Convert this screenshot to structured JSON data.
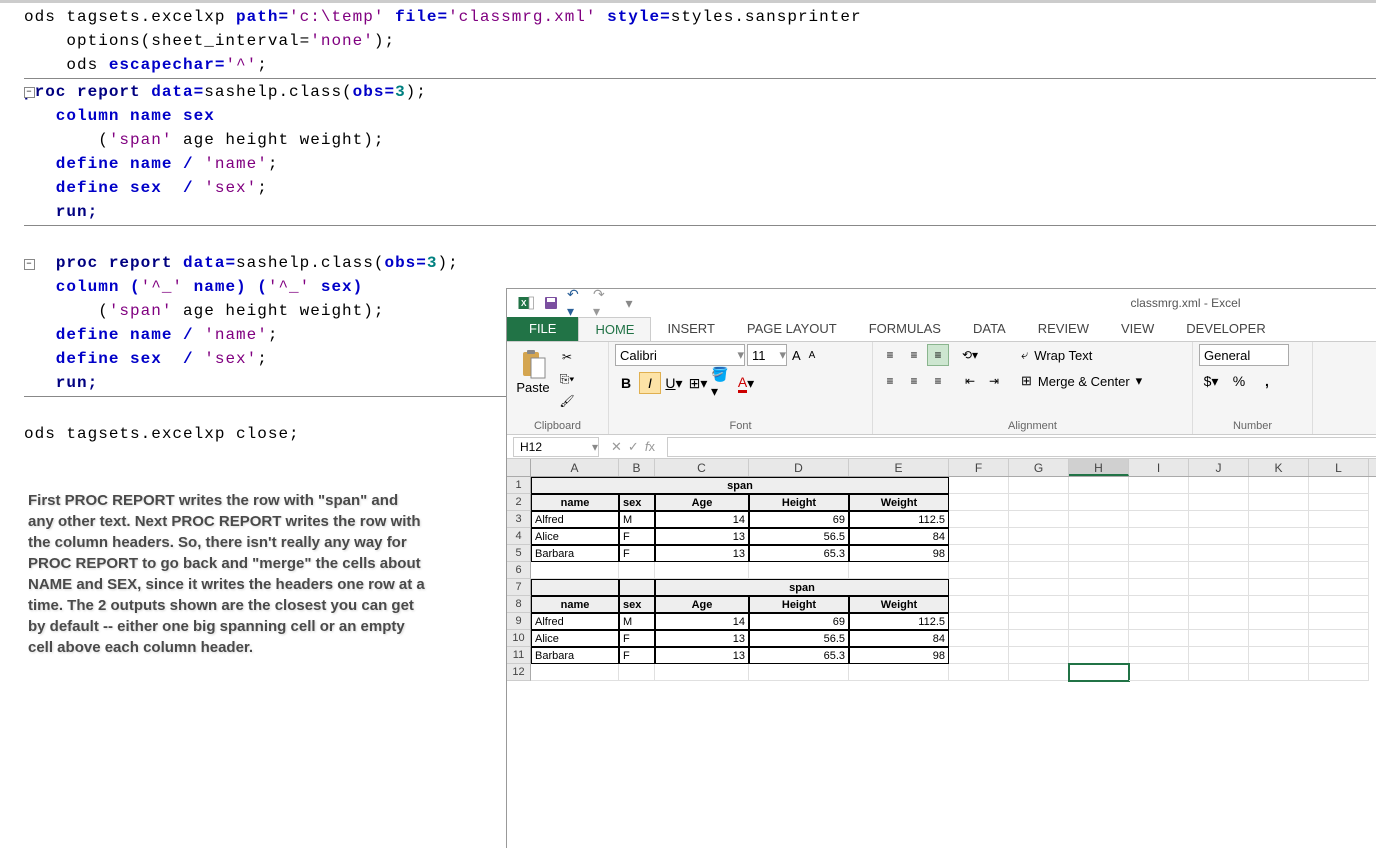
{
  "code": {
    "l1": "ods tagsets.excelxp ",
    "path_kw": "path=",
    "path_val": "'c:\\temp'",
    "file_kw": " file=",
    "file_val": "'classmrg.xml'",
    "style_kw": " style=",
    "style_val": "styles.sansprinter",
    "l2a": "    options(sheet_interval=",
    "l2b": "'none'",
    "l2c": ");",
    "l3a": "    ods ",
    "l3b": "escapechar=",
    "l3c": "'^'",
    "l3d": ";",
    "proc1_a": "proc",
    "proc1_b": " report",
    "proc1_c": " data=",
    "proc1_d": "sashelp.class(",
    "proc1_e": "obs=",
    "proc1_f": "3",
    "proc1_g": ");",
    "col1a": "   column name sex",
    "col1b": "       (",
    "col1b2": "'span'",
    "col1b3": " age height weight);",
    "def1a": "   define name / ",
    "def1a2": "'name'",
    "def1a3": ";",
    "def1b": "   define sex  / ",
    "def1b2": "'sex'",
    "def1b3": ";",
    "run": "   run;",
    "proc2_pre": "   ",
    "col2a": "   column (",
    "col2a2": "'^_'",
    "col2a3": " name) (",
    "col2a4": "'^_'",
    "col2a5": " sex)",
    "col2b": "       (",
    "col2b2": "'span'",
    "col2b3": " age height weight);",
    "close": "ods tagsets.excelxp close;"
  },
  "explanation": "First PROC REPORT writes the row with \"span\" and any other text. Next PROC REPORT writes the row with the column headers. So, there isn't really any way for PROC REPORT to go back and \"merge\" the cells about NAME and SEX, since it writes the headers one row at a time. The 2 outputs shown are the closest you can get by default -- either one big spanning cell or an empty cell above each column header.",
  "excel": {
    "title": "classmrg.xml - Excel",
    "tabs": {
      "file": "FILE",
      "home": "HOME",
      "insert": "INSERT",
      "page": "PAGE LAYOUT",
      "formulas": "FORMULAS",
      "data": "DATA",
      "review": "REVIEW",
      "view": "VIEW",
      "developer": "DEVELOPER"
    },
    "clipboard": {
      "paste": "Paste",
      "label": "Clipboard"
    },
    "font": {
      "name": "Calibri",
      "size": "11",
      "label": "Font"
    },
    "align": {
      "wrap": "Wrap Text",
      "merge": "Merge & Center",
      "label": "Alignment"
    },
    "number": {
      "format": "General",
      "label": "Number"
    },
    "namebox": "H12",
    "cols": [
      "A",
      "B",
      "C",
      "D",
      "E",
      "F",
      "G",
      "H",
      "I",
      "J",
      "K",
      "L"
    ],
    "span": "span",
    "hdr": {
      "name": "name",
      "sex": "sex",
      "age": "Age",
      "height": "Height",
      "weight": "Weight"
    },
    "rows1": [
      {
        "name": "Alfred",
        "sex": "M",
        "age": "14",
        "height": "69",
        "weight": "112.5"
      },
      {
        "name": "Alice",
        "sex": "F",
        "age": "13",
        "height": "56.5",
        "weight": "84"
      },
      {
        "name": "Barbara",
        "sex": "F",
        "age": "13",
        "height": "65.3",
        "weight": "98"
      }
    ],
    "rows2": [
      {
        "name": "Alfred",
        "sex": "M",
        "age": "14",
        "height": "69",
        "weight": "112.5"
      },
      {
        "name": "Alice",
        "sex": "F",
        "age": "13",
        "height": "56.5",
        "weight": "84"
      },
      {
        "name": "Barbara",
        "sex": "F",
        "age": "13",
        "height": "65.3",
        "weight": "98"
      }
    ]
  },
  "chart_data": {
    "type": "table",
    "tables": [
      {
        "span_header": "span",
        "columns": [
          "name",
          "sex",
          "Age",
          "Height",
          "Weight"
        ],
        "rows": [
          [
            "Alfred",
            "M",
            14,
            69,
            112.5
          ],
          [
            "Alice",
            "F",
            13,
            56.5,
            84
          ],
          [
            "Barbara",
            "F",
            13,
            65.3,
            98
          ]
        ]
      },
      {
        "span_header": "span",
        "columns": [
          "name",
          "sex",
          "Age",
          "Height",
          "Weight"
        ],
        "rows": [
          [
            "Alfred",
            "M",
            14,
            69,
            112.5
          ],
          [
            "Alice",
            "F",
            13,
            56.5,
            84
          ],
          [
            "Barbara",
            "F",
            13,
            65.3,
            98
          ]
        ]
      }
    ]
  }
}
